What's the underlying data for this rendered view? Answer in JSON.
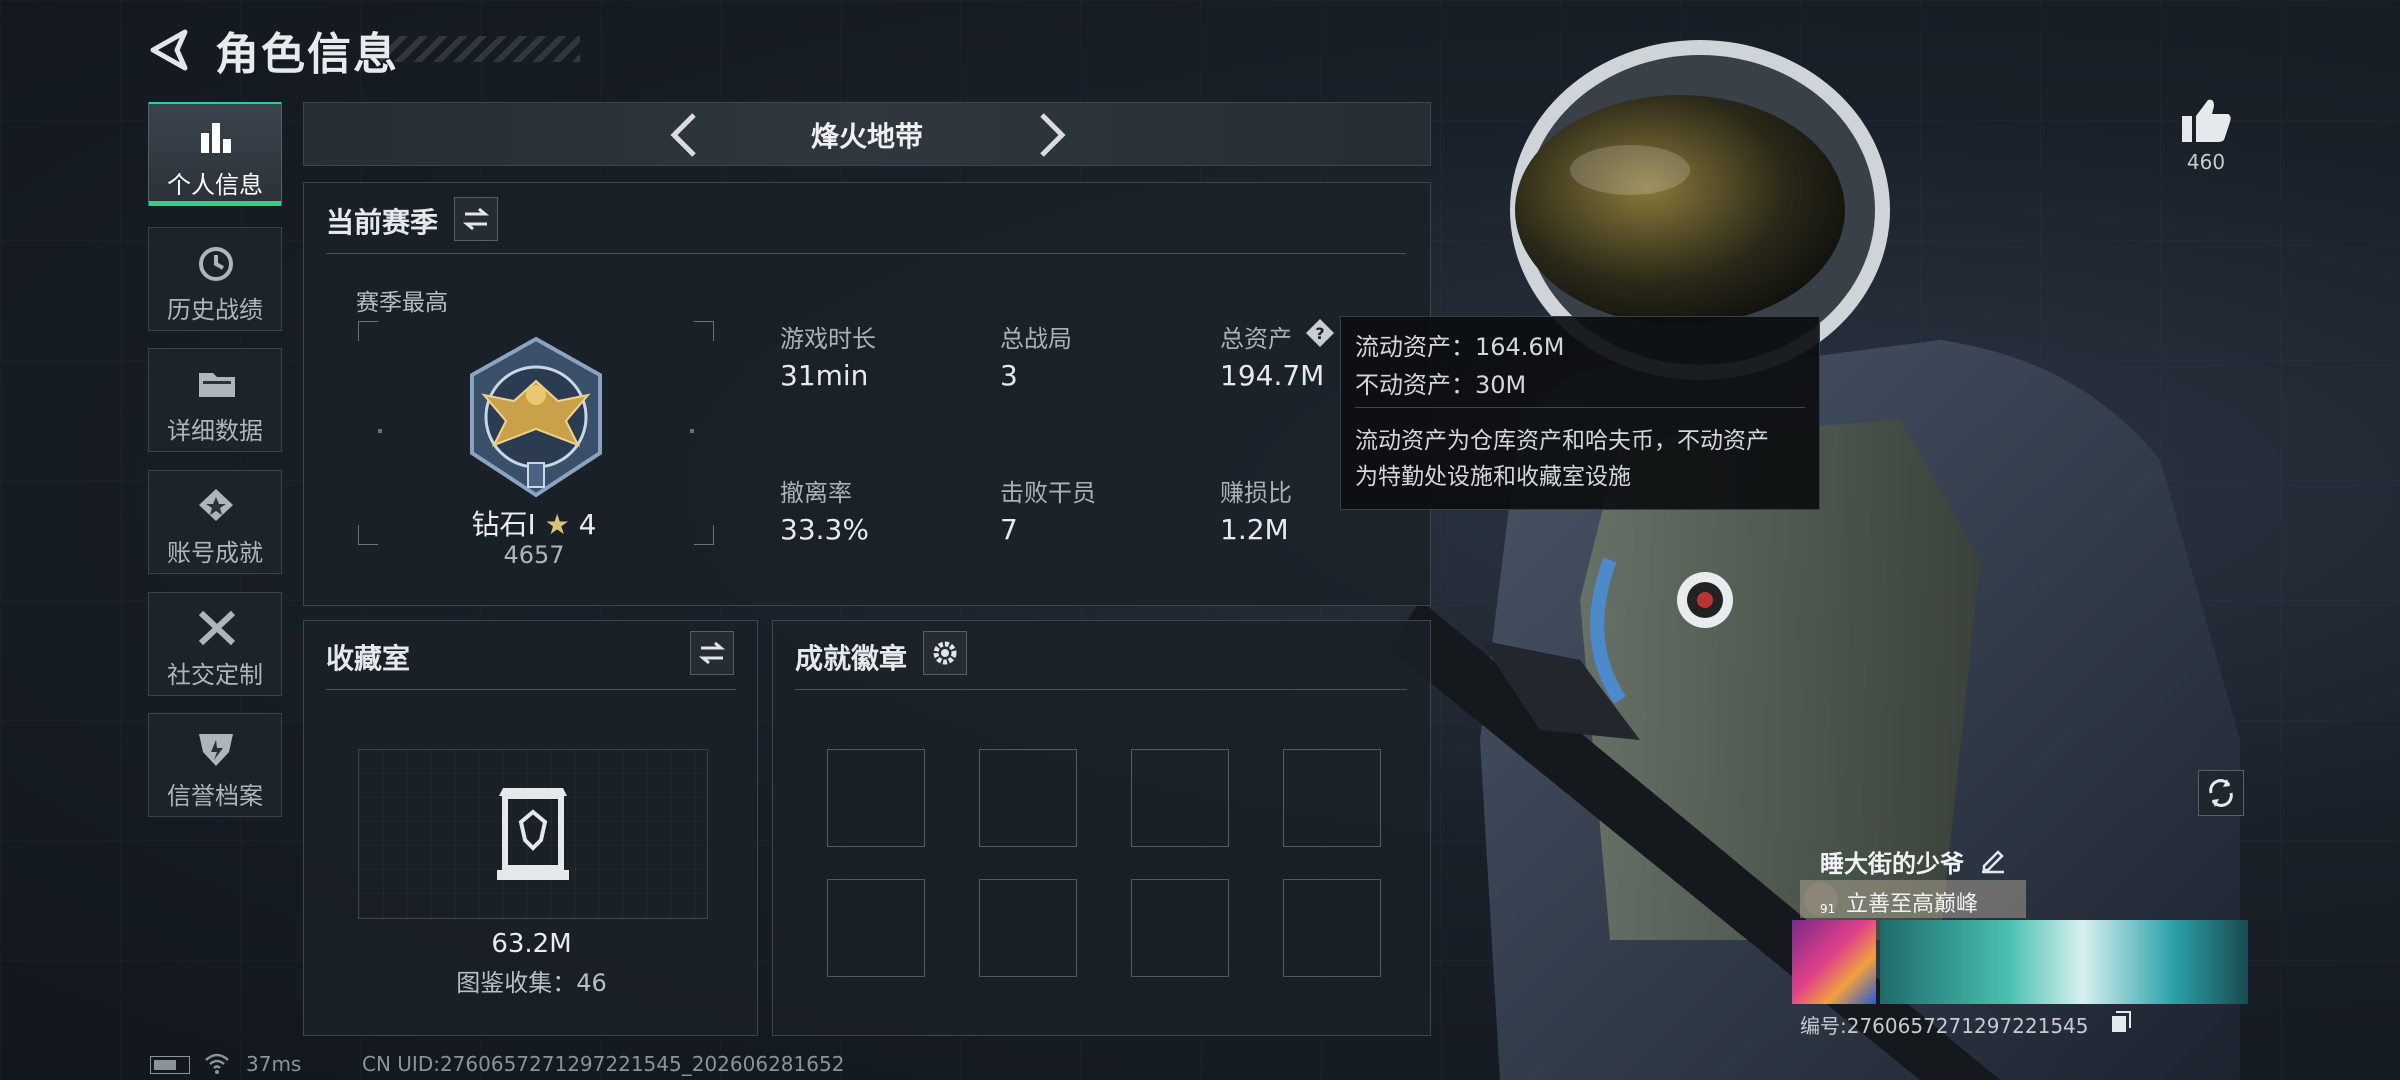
{
  "header": {
    "title": "角色信息"
  },
  "sidebar": {
    "items": [
      {
        "label": "个人信息",
        "icon": "bar-chart-icon",
        "active": true
      },
      {
        "label": "历史战绩",
        "icon": "history-clock-icon"
      },
      {
        "label": "详细数据",
        "icon": "folder-icon"
      },
      {
        "label": "账号成就",
        "icon": "star-achievement-icon"
      },
      {
        "label": "社交定制",
        "icon": "wrench-tools-icon"
      },
      {
        "label": "信誉档案",
        "icon": "credit-shield-icon"
      }
    ]
  },
  "mode": {
    "title": "烽火地带"
  },
  "season": {
    "title": "当前赛季",
    "best_label": "赛季最高",
    "rank_name": "钻石Ⅰ",
    "rank_stars": "4",
    "rank_score": "4657",
    "stats": [
      {
        "label": "游戏时长",
        "value": "31min"
      },
      {
        "label": "总战局",
        "value": "3"
      },
      {
        "label": "总资产",
        "value": "194.7M"
      },
      {
        "label": "撤离率",
        "value": "33.3%"
      },
      {
        "label": "击败干员",
        "value": "7"
      },
      {
        "label": "赚损比",
        "value": "1.2M"
      }
    ]
  },
  "tooltip": {
    "line1": "流动资产：164.6M",
    "line2": "不动资产：30M",
    "desc1": "流动资产为仓库资产和哈夫币，不动资产",
    "desc2": "为特勤处设施和收藏室设施"
  },
  "collection": {
    "title": "收藏室",
    "value": "63.2M",
    "count_text": "图鉴收集：46"
  },
  "badges": {
    "title": "成就徽章",
    "slots": 8
  },
  "likes": {
    "count": "460"
  },
  "player": {
    "name": "睡大街的少爷",
    "level": "91",
    "motto": "立善至高巅峰",
    "id_text": "编号:2760657271297221545"
  },
  "status_bar": {
    "ping": "37ms",
    "uid": "CN UID:2760657271297221545_202606281652"
  },
  "colors": {
    "accent": "#2ed08c",
    "panel": "#1b2128",
    "border": "#3c4550"
  }
}
